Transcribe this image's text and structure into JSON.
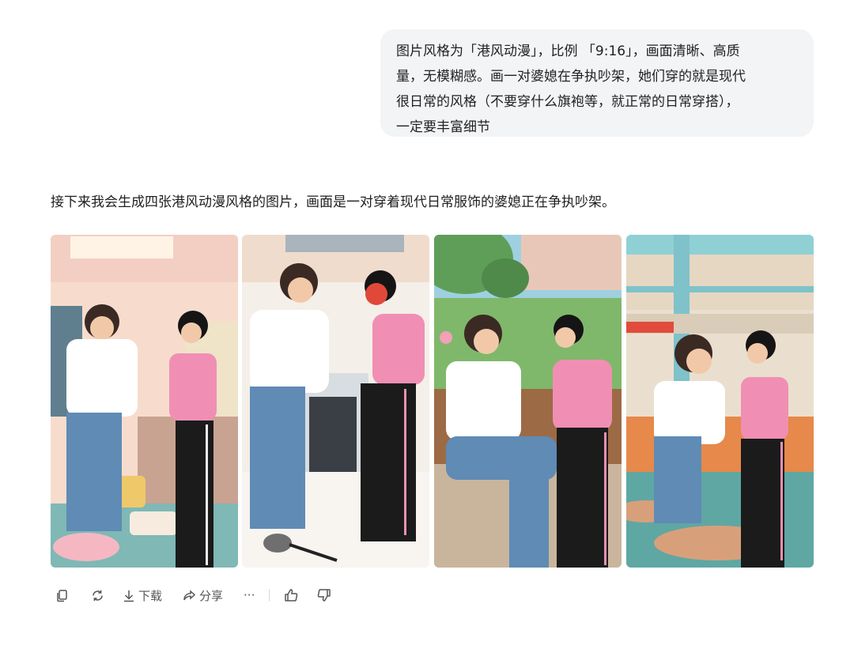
{
  "user_message": {
    "lines": [
      "图片风格为「港风动漫」，比例 「9:16」，画面清晰、高质",
      "量，无模糊感。画一对婆媳在争执吵架，她们穿的就是现代",
      "很日常的风格（不要穿什么旗袍等，就正常的日常穿搭），",
      "一定要丰富细节"
    ]
  },
  "assistant_reply": {
    "text": "接下来我会生成四张港风动漫风格的图片，画面是一对穿着现代日常服饰的婆媳正在争执吵架。"
  },
  "images": [
    {
      "icon": "living-room-argument-illustration"
    },
    {
      "icon": "kitchen-argument-illustration"
    },
    {
      "icon": "park-bench-argument-illustration"
    },
    {
      "icon": "shopping-mall-argument-illustration"
    }
  ],
  "actions": {
    "copy_icon": "copy-icon",
    "regenerate_icon": "regenerate-icon",
    "download_label": "下载",
    "share_label": "分享",
    "more_label": "···",
    "like_icon": "thumbs-up-icon",
    "dislike_icon": "thumbs-down-icon"
  },
  "colors": {
    "bubble_bg": "#f3f4f6",
    "text": "#1f1f1f",
    "action_icon": "#555555"
  }
}
